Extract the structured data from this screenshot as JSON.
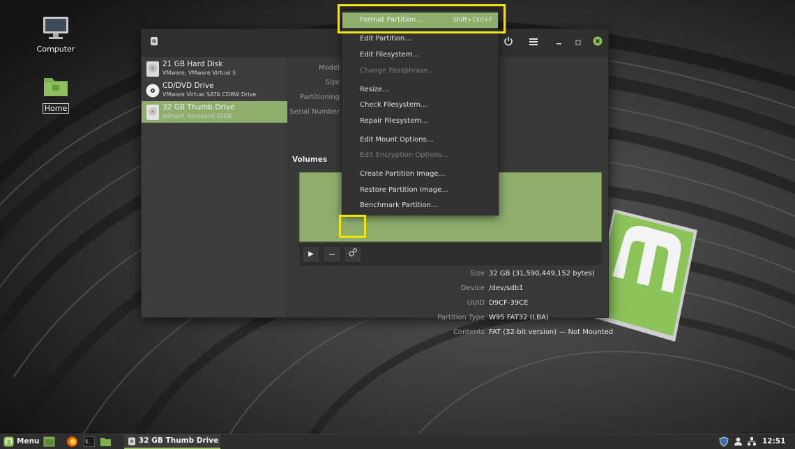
{
  "desktop": {
    "icons": [
      {
        "label": "Computer"
      },
      {
        "label": "Home"
      }
    ]
  },
  "devices": [
    {
      "name": "21 GB Hard Disk",
      "sub": "VMware, VMware Virtual S"
    },
    {
      "name": "CD/DVD Drive",
      "sub": "VMware Virtual SATA CDRW Drive"
    },
    {
      "name": "32 GB Thumb Drive",
      "sub": "JetFlash Transcend 32GB",
      "selected": true
    }
  ],
  "drive_info": {
    "labels": [
      "Model",
      "Size",
      "Partitioning",
      "Serial Number"
    ]
  },
  "volumes": {
    "heading": "Volumes",
    "toolbar": {
      "play": "▶",
      "minus": "−"
    }
  },
  "partition_details": {
    "rows": [
      {
        "label": "Size",
        "value": "32 GB (31,590,449,152 bytes)"
      },
      {
        "label": "Device",
        "value": "/dev/sdb1"
      },
      {
        "label": "UUID",
        "value": "D9CF-39CE"
      },
      {
        "label": "Partition Type",
        "value": "W95 FAT32 (LBA)"
      },
      {
        "label": "Contents",
        "value": "FAT (32-bit version) — Not Mounted"
      }
    ]
  },
  "menu": {
    "items": [
      {
        "label": "Format Partition…",
        "shortcut": "Shift+Ctrl+F",
        "highlight": true
      },
      {
        "label": "Edit Partition…"
      },
      {
        "label": "Edit Filesystem…"
      },
      {
        "label": "Change Passphrase…",
        "disabled": true
      },
      {
        "label": "Resize…"
      },
      {
        "label": "Check Filesystem…"
      },
      {
        "label": "Repair Filesystem…"
      },
      {
        "label": "Edit Mount Options…"
      },
      {
        "label": "Edit Encryption Options…",
        "disabled": true
      },
      {
        "label": "Create Partition Image…"
      },
      {
        "label": "Restore Partition Image…"
      },
      {
        "label": "Benchmark Partition…"
      }
    ]
  },
  "taskbar": {
    "menu_label": "Menu",
    "task_label": "32 GB Thumb Drive",
    "clock": "12:51"
  },
  "colors": {
    "accent_green": "#8fad6d",
    "highlight_yellow": "#f2e40f",
    "window_bg": "#383838"
  }
}
